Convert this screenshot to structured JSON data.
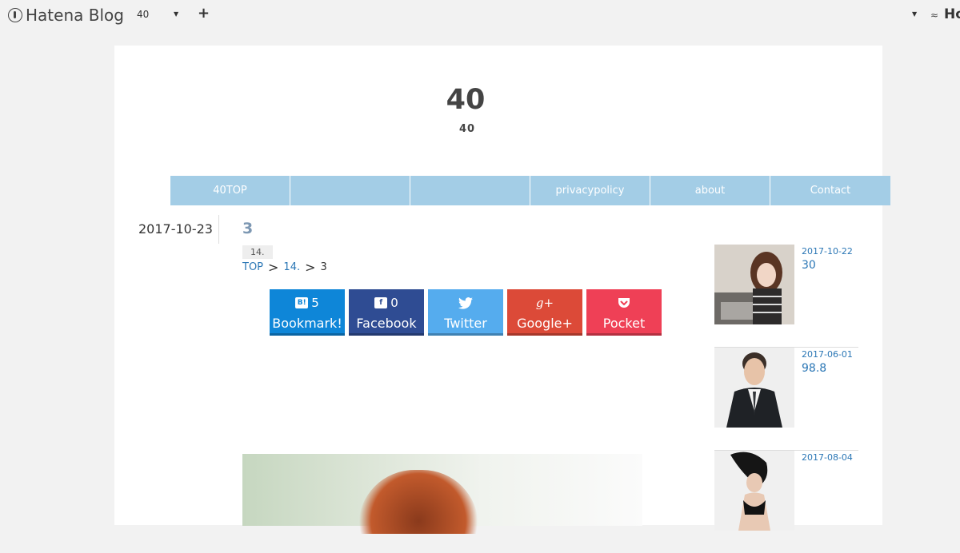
{
  "topbar": {
    "logo_text": "Hatena Blog",
    "blog_name": "40",
    "right_text": "Ho"
  },
  "header": {
    "title": "40",
    "subtitle": "40"
  },
  "nav": [
    "40TOP",
    "",
    "",
    "privacypolicy",
    "about",
    "Contact"
  ],
  "entry": {
    "date": "2017-10-23",
    "title": "3",
    "category": "14.",
    "breadcrumb": {
      "top": "TOP",
      "sep": ">",
      "cat": "14.",
      "current": "3"
    }
  },
  "share": {
    "hatena": {
      "count": "5",
      "label": "Bookmark!",
      "color": "#0e86d8"
    },
    "facebook": {
      "count": "0",
      "label": "Facebook",
      "color": "#2f4c93"
    },
    "twitter": {
      "label": "Twitter",
      "color": "#55acee"
    },
    "google": {
      "label": "Google+",
      "color": "#dc4a38"
    },
    "pocket": {
      "label": "Pocket",
      "color": "#ef4056"
    }
  },
  "sidebar": [
    {
      "date": "2017-10-22",
      "title": "30"
    },
    {
      "date": "2017-06-01",
      "title": "98.8"
    },
    {
      "date": "2017-08-04",
      "title": ""
    }
  ]
}
